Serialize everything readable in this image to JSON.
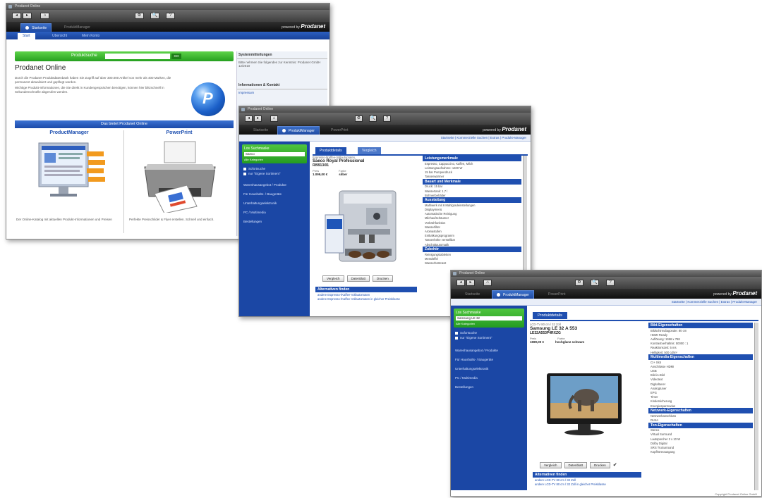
{
  "window1": {
    "title": "Prodanet Online",
    "toolbar_buttons": [
      "◂",
      "▸",
      "⌂",
      "⚙",
      "🔍",
      "?"
    ],
    "app_tabs": [
      "Startseite",
      "ProduktManager"
    ],
    "powered_by": "powered by",
    "brand": "Prodanet",
    "sub_tabs": [
      "Start",
      "Ubersicht",
      "Mein Konto"
    ],
    "search_label": "Produktsuche",
    "search_go": "GO",
    "heading": "Prodanet Online",
    "intro_text": "Durch die Prodanet Produktdatenbank haben Sie Zugriff auf über 300.000 Artikel von mehr als 400 Marken, die permanent aktualisiert und gepflegt werden.",
    "intro_text2": "Wichtige Produkt-Informationen, die Sie direkt in Kundengesprächen benötigen, können hier blitzschnell in Sekundenschnelle abgerufen werden.",
    "banner": "Das bietet Prodanet Online",
    "left_heading": "ProductManager",
    "left_desc": "Der Online-Katalog mit aktuellen Produkt-Informationen und Preisen",
    "right_heading": "PowerPrint",
    "right_desc": "Perfekte Preisschilder & Flyer erstellen. Schnell und einfach.",
    "side_h1": "Systemmitteilungen",
    "side_t1": "Bitte nehmen Sie folgendes zur Kenntnis: Prodanet GmbH 12/2010",
    "side_h2": "Informationen & Kontakt",
    "side_t2": "Impressum"
  },
  "window2": {
    "title": "Prodanet Online",
    "toolbar_buttons": [
      "◂",
      "▸",
      "⌂",
      "⚙",
      "🔍",
      "?"
    ],
    "app_tabs": [
      "Startseite",
      "ProduktManager",
      "PowerPrint"
    ],
    "powered_by": "powered by",
    "brand": "Prodanet",
    "links": "Startseite | Kommerzielle Suchen | Extras | Produkt-Manager",
    "search_label": "Los Suchmaske",
    "search_value": "Saeco",
    "search_extra": "Alle Kategorien",
    "checks": [
      "Sofortsuche",
      "nur \"Eigene Sortiment\""
    ],
    "nav": [
      "Warenhausangebot / Produkte",
      "Für Haushalts- / Baugeräte",
      "Unterhaltungselektronik",
      "PC / Multimedia",
      "Bestellungen"
    ],
    "tabs": [
      "Produktdetails",
      "Vergleich"
    ],
    "product_category": "Espresso-/Kaffee-Vollautomaten",
    "product_name": "Saeco Royal Professional",
    "product_sku": "RI9913/01",
    "price_label": "Preis",
    "price": "1.099,00 €",
    "color_label": "Farbe",
    "color": "silber",
    "buttons": [
      "Vergleich",
      "Datenblatt",
      "Drucken"
    ],
    "more_header": "Alternativen finden",
    "more_links": [
      "andere Espresso-/Kaffee-Vollautomaten",
      "andere Espresso-/Kaffee-Vollautomaten in gleicher Preisklasse"
    ],
    "feat_headers": [
      "Leistungsmerkmale",
      "Bauart und Merkmale",
      "Ausstattung",
      "Zubehör"
    ],
    "feat_items1": [
      "Espresso, Cappuccino, Kaffee, Milch",
      "Leistungsaufnahme: 1400 W",
      "15 bar Pumpendruck",
      "Tassenwärmer"
    ],
    "feat_items2": [
      "Druck: 15 bar",
      "Wassertank: 1,7 l",
      "Bohnenbehälter"
    ],
    "feat_items3": [
      "Mahlwerk mit 6 Mahlgradeinstellungen",
      "Displaymenü",
      "Automatische Reinigung",
      "Milchaufschäumer",
      "Vorbrühfunktion",
      "Wasserfilter",
      "Aromastufen",
      "Entkalkungsprogramm",
      "Tassenhöhe verstellbar",
      "Abschaltautomatik"
    ],
    "feat_items4": [
      "Reinigungstabletten",
      "Messlöffel",
      "Wasserhärtetest"
    ]
  },
  "window3": {
    "title": "Prodanet Online",
    "toolbar_buttons": [
      "◂",
      "▸",
      "⌂",
      "⚙",
      "🔍",
      "?"
    ],
    "app_tabs": [
      "Startseite",
      "ProduktManager",
      "PowerPrint"
    ],
    "powered_by": "powered by",
    "brand": "Prodanet",
    "links": "Startseite | Kommerzielle Suchen | Extras | Produkt-Manager",
    "search_label": "Los Suchmaske",
    "search_value": "Samsung LE 32",
    "search_extra": "Alle Kategorien",
    "checks": [
      "Sofortsuche",
      "nur \"Eigene Sortiment\""
    ],
    "nav": [
      "Warenhausangebot / Produkte",
      "Für Haushalts- / Baugeräte",
      "Unterhaltungselektronik",
      "PC / Multimedia",
      "Bestellungen"
    ],
    "tabs": [
      "Produktdetails"
    ],
    "product_category": "LCD-TV 80 cm / 32 Zoll",
    "product_name": "Samsung LE 32 A 553",
    "product_sku": "LE32A553P4RXZG",
    "price_label": "Preis",
    "price": "1599,00 €",
    "color_label": "Farbe",
    "color": "hochglanz schwarz",
    "buttons": [
      "Vergleich",
      "Datenblatt",
      "Drucken"
    ],
    "more_header": "Alternativen finden",
    "more_links": [
      "andere LCD-TV 80 cm / 32 Zoll",
      "andere LCD-TV 80 cm / 32 Zoll in gleicher Preisklasse"
    ],
    "feat_headers": [
      "Bild-Eigenschaften",
      "Multimedia-Eigenschaften",
      "Netzwerk-Eigenschaften",
      "Ton-Eigenschaften"
    ],
    "feat_items1": [
      "Bildschirmdiagonale: 80 cm",
      "HDMI Ready",
      "Auflösung: 1366 x 768",
      "Kontrastverhältnis: 50000 : 1",
      "Reaktionszeit: 5 ms",
      "Helligkeit: 500 cd/m²"
    ],
    "feat_items2": [
      "CI+ Slot",
      "Anschlüsse HDMI",
      "USB",
      "Bild-in-Bild",
      "Videotext",
      "Digitaltuner",
      "Analogtuner",
      "EPG",
      "Timer",
      "Kindersicherung",
      "Energiesparmodus"
    ],
    "feat_items3": [
      "Netzwerkanschluss",
      "DLNA"
    ],
    "feat_items4": [
      "Stereo",
      "Virtual Surround",
      "Lautsprecher 2 x 10 W",
      "Dolby Digital",
      "SRS TruSurround",
      "Kopfhörerausgang"
    ],
    "footer": "Copyright Prodanet Online GmbH"
  }
}
